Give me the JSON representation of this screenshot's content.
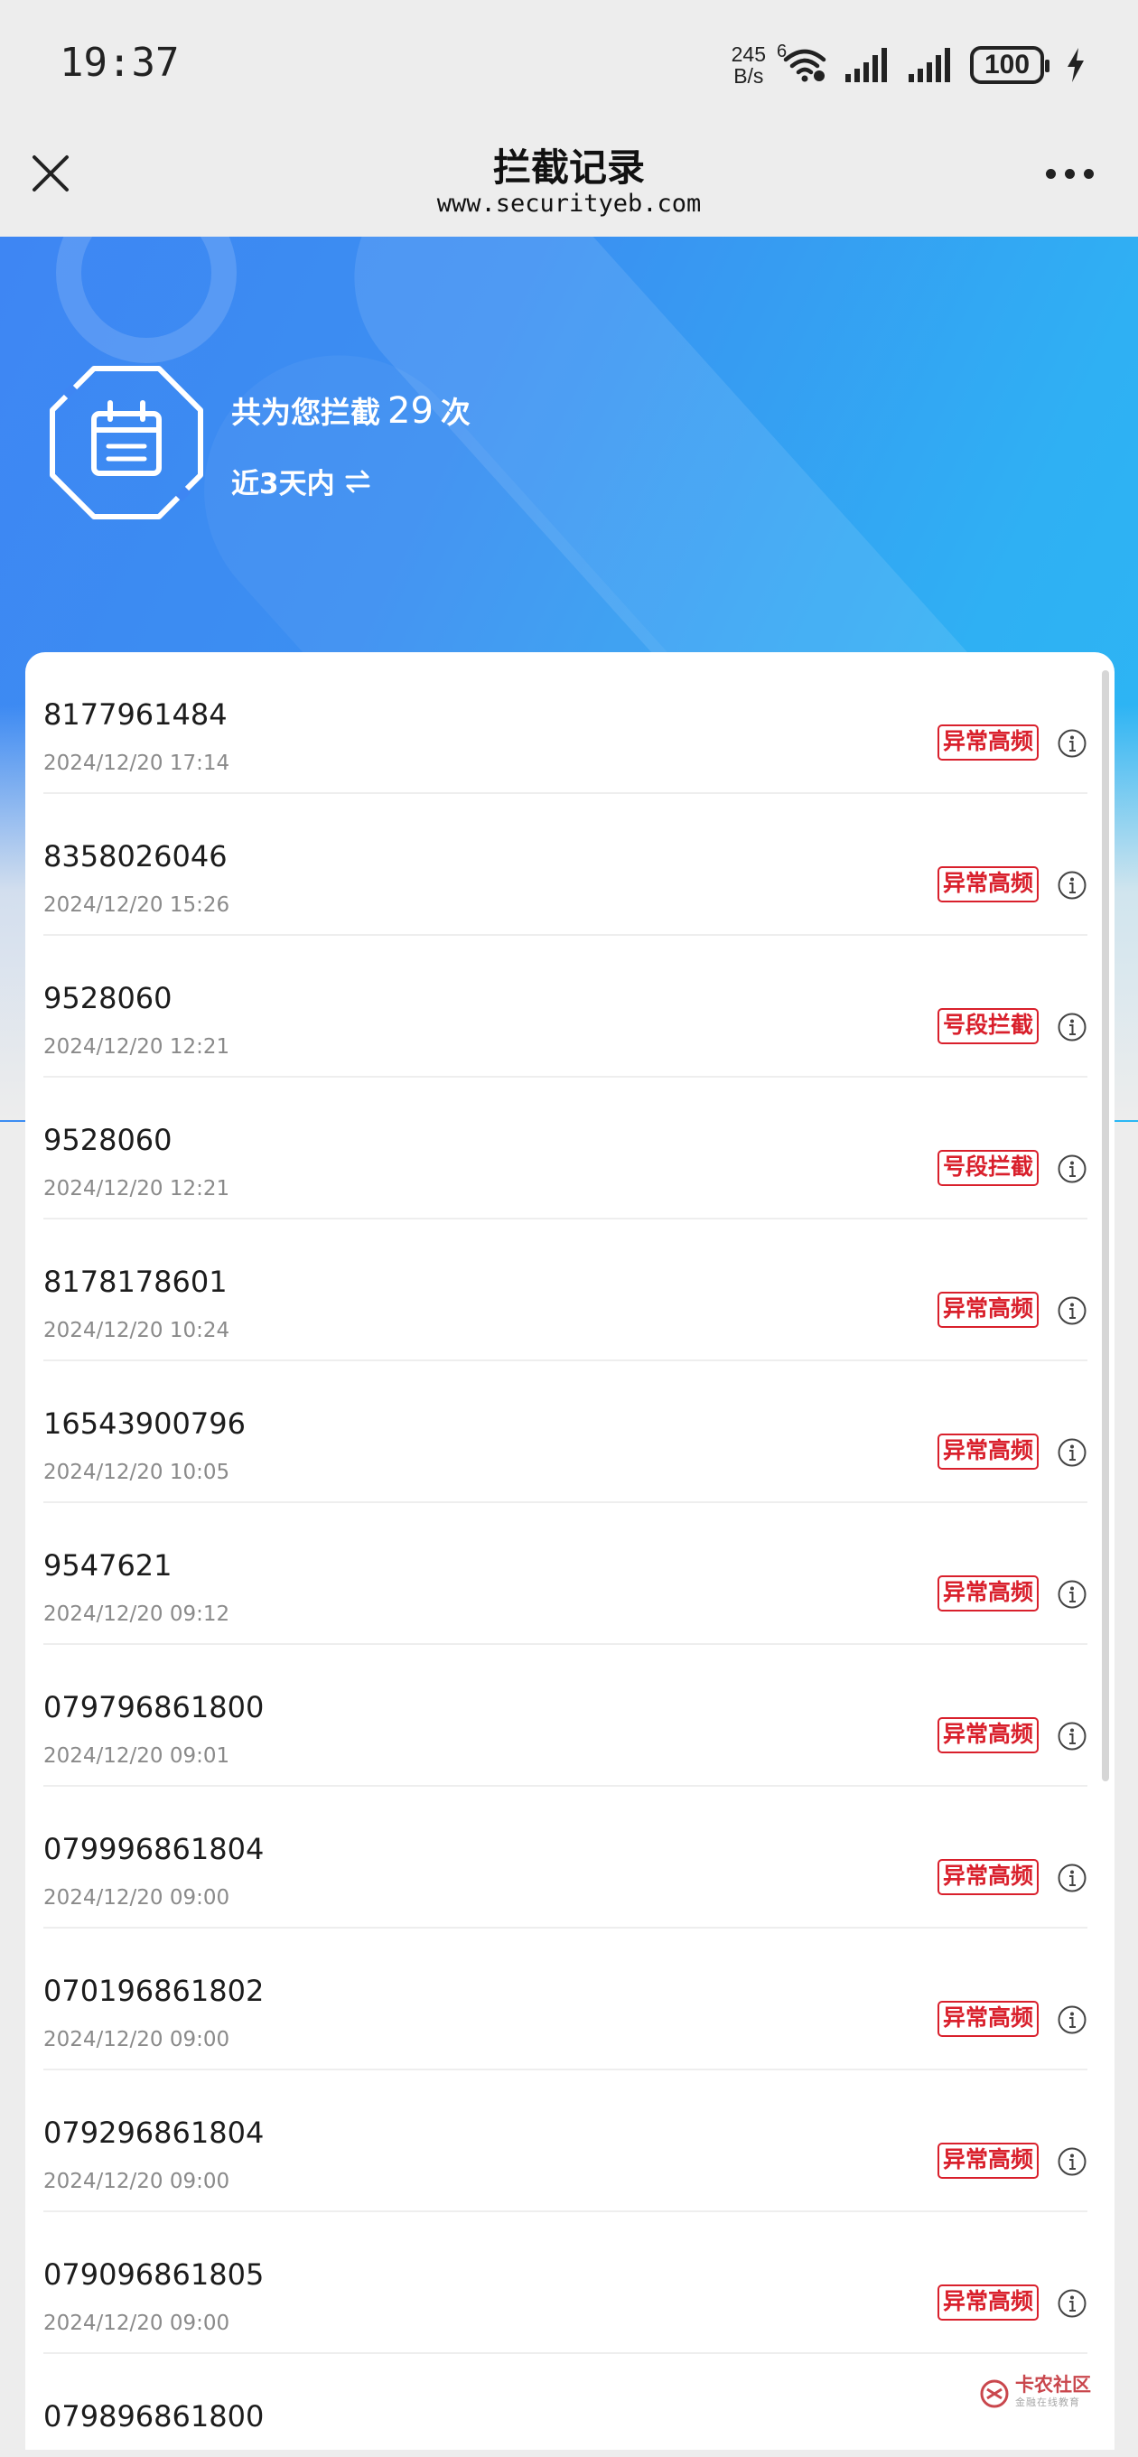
{
  "status_bar": {
    "time": "19:37",
    "net_speed_value": "245",
    "net_speed_unit": "B/s",
    "wifi_badge": "6",
    "battery": "100",
    "icons": [
      "wifi-6-icon",
      "signal-icon",
      "signal-icon",
      "battery-icon",
      "charging-bolt-icon"
    ]
  },
  "title_bar": {
    "title": "拦截记录",
    "url": "www.securityeb.com"
  },
  "summary": {
    "count_prefix": "共为您拦截",
    "count_value": "29",
    "count_suffix": "次",
    "range_label": "近3天内"
  },
  "records": [
    {
      "number": "8177961484",
      "time": "2024/12/20 17:14",
      "tag": "异常高频"
    },
    {
      "number": "8358026046",
      "time": "2024/12/20 15:26",
      "tag": "异常高频"
    },
    {
      "number": "9528060",
      "time": "2024/12/20 12:21",
      "tag": "号段拦截"
    },
    {
      "number": "9528060",
      "time": "2024/12/20 12:21",
      "tag": "号段拦截"
    },
    {
      "number": "8178178601",
      "time": "2024/12/20 10:24",
      "tag": "异常高频"
    },
    {
      "number": "16543900796",
      "time": "2024/12/20 10:05",
      "tag": "异常高频"
    },
    {
      "number": "9547621",
      "time": "2024/12/20 09:12",
      "tag": "异常高频"
    },
    {
      "number": "079796861800",
      "time": "2024/12/20 09:01",
      "tag": "异常高频"
    },
    {
      "number": "079996861804",
      "time": "2024/12/20 09:00",
      "tag": "异常高频"
    },
    {
      "number": "070196861802",
      "time": "2024/12/20 09:00",
      "tag": "异常高频"
    },
    {
      "number": "079296861804",
      "time": "2024/12/20 09:00",
      "tag": "异常高频"
    },
    {
      "number": "079096861805",
      "time": "2024/12/20 09:00",
      "tag": "异常高频"
    },
    {
      "number": "079896861800",
      "time": "",
      "tag": ""
    }
  ],
  "watermark": {
    "main": "卡农社区",
    "sub": "金融在线教育"
  },
  "colors": {
    "hero_start": "#3e86f3",
    "hero_end": "#2bb8f4",
    "tag_red": "#d9202c"
  }
}
